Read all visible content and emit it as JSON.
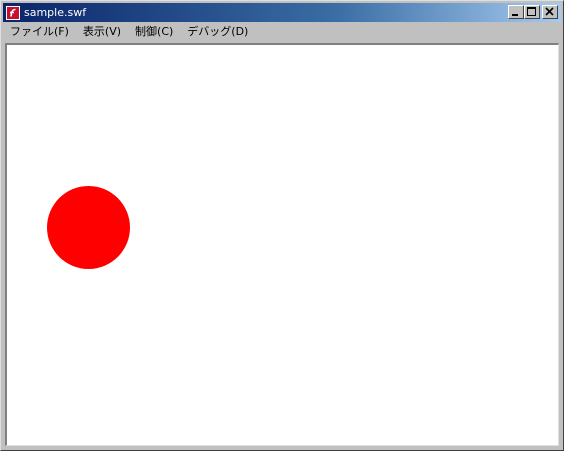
{
  "window": {
    "title": "sample.swf"
  },
  "title_buttons": {
    "minimize_icon": "minimize-icon",
    "maximize_icon": "maximize-icon",
    "close_icon": "close-icon"
  },
  "menu": {
    "items": [
      {
        "label": "ファイル(F)"
      },
      {
        "label": "表示(V)"
      },
      {
        "label": "制御(C)"
      },
      {
        "label": "デバッグ(D)"
      }
    ]
  },
  "content": {
    "shape": "circle",
    "color": "#ff0000"
  },
  "colors": {
    "titlebar_start": "#0a246a",
    "titlebar_end": "#a6caf0",
    "canvas_bg": "#ffffff",
    "chrome": "#c0c0c0"
  }
}
